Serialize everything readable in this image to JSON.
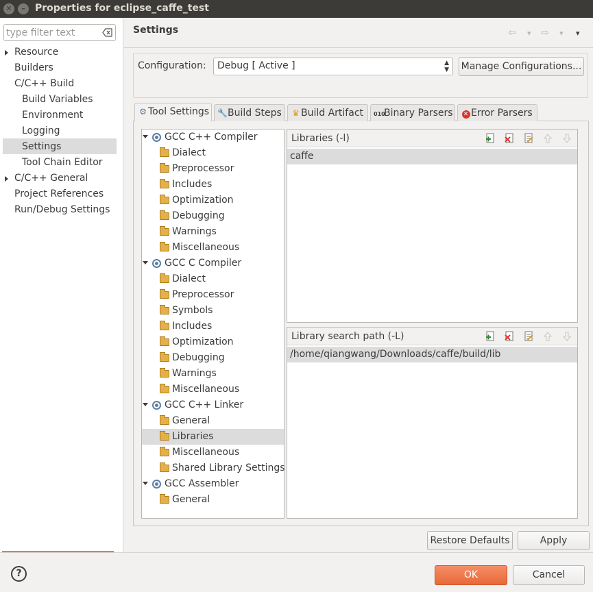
{
  "window": {
    "title": "Properties for eclipse_caffe_test",
    "controls": [
      "✕",
      "–"
    ]
  },
  "filter": {
    "placeholder": "type filter text",
    "value": ""
  },
  "nav": {
    "items": [
      {
        "label": "Resource"
      },
      {
        "label": "Builders"
      },
      {
        "label": "C/C++ Build"
      },
      {
        "label": "Build Variables"
      },
      {
        "label": "Environment"
      },
      {
        "label": "Logging"
      },
      {
        "label": "Settings"
      },
      {
        "label": "Tool Chain Editor"
      },
      {
        "label": "C/C++ General"
      },
      {
        "label": "Project References"
      },
      {
        "label": "Run/Debug Settings"
      }
    ]
  },
  "header": {
    "title": "Settings",
    "back_icon": "⇦",
    "forward_icon": "⇨",
    "dropdown_icon": "▾",
    "menu_icon": "⏷"
  },
  "config": {
    "label": "Configuration:",
    "value": "Debug  [ Active ]",
    "manage_label": "Manage Configurations..."
  },
  "tabs": [
    {
      "label": "Tool Settings",
      "icon": "gear-icon"
    },
    {
      "label": "Build Steps",
      "icon": "wrench-icon"
    },
    {
      "label": "Build Artifact",
      "icon": "trophy-icon"
    },
    {
      "label": "Binary Parsers",
      "icon": "binary-icon"
    },
    {
      "label": "Error Parsers",
      "icon": "error-icon"
    }
  ],
  "tree": {
    "cpp_compiler": "GCC C++ Compiler",
    "cpp_compiler_children": [
      "Dialect",
      "Preprocessor",
      "Includes",
      "Optimization",
      "Debugging",
      "Warnings",
      "Miscellaneous"
    ],
    "c_compiler": "GCC C Compiler",
    "c_compiler_children": [
      "Dialect",
      "Preprocessor",
      "Symbols",
      "Includes",
      "Optimization",
      "Debugging",
      "Warnings",
      "Miscellaneous"
    ],
    "cpp_linker": "GCC C++ Linker",
    "cpp_linker_children": [
      "General",
      "Libraries",
      "Miscellaneous",
      "Shared Library Settings"
    ],
    "assembler": "GCC Assembler",
    "assembler_children": [
      "General"
    ]
  },
  "libraries": {
    "title": "Libraries (-l)",
    "items": [
      "caffe"
    ]
  },
  "library_paths": {
    "title": "Library search path (-L)",
    "items": [
      "/home/qiangwang/Downloads/caffe/build/lib"
    ]
  },
  "buttons": {
    "restore_defaults": "Restore Defaults",
    "apply": "Apply",
    "ok": "OK",
    "cancel": "Cancel",
    "help": "?"
  },
  "colors": {
    "titlebar": "#3c3b37",
    "accent": "#f07746",
    "selection": "#dcdcdc"
  }
}
